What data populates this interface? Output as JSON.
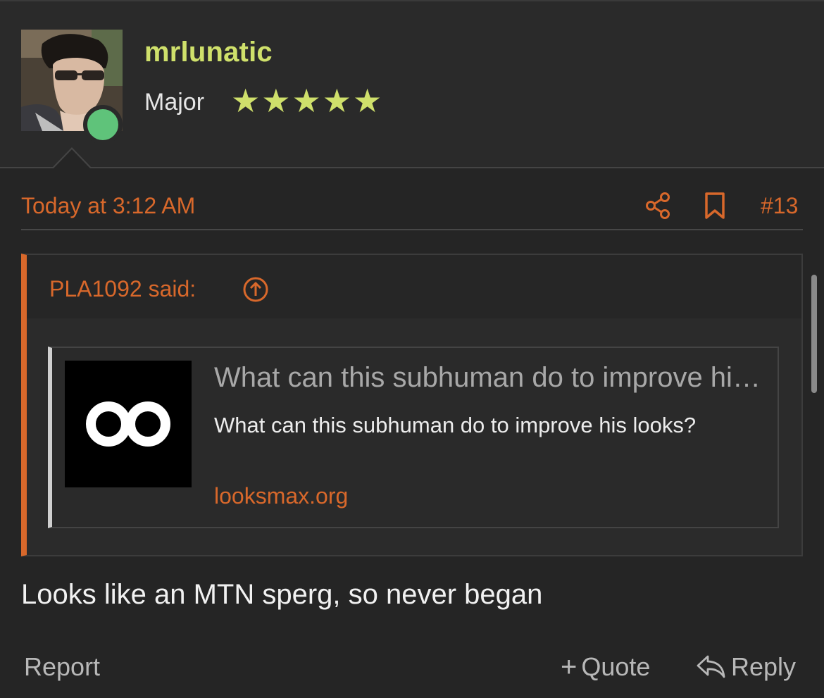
{
  "user": {
    "username": "mrlunatic",
    "title": "Major",
    "stars": "★★★★★",
    "rating": 5,
    "online": true,
    "avatar_icon": "user-avatar"
  },
  "post": {
    "time": "Today at 3:12 AM",
    "number": "#13",
    "body": "Looks like an MTN sperg, so never began"
  },
  "quote": {
    "author_label": "PLA1092 said:",
    "embed": {
      "title": "What can this subhuman do to improve his looks?",
      "description": "What can this subhuman do to improve his looks?",
      "domain": "looksmax.org",
      "thumb_icon": "looksmax-logo-icon"
    }
  },
  "actions": {
    "report": "Report",
    "quote": "Quote",
    "reply": "Reply"
  },
  "colors": {
    "accent": "#d8682b",
    "username": "#cfe06b",
    "online": "#5fc37a",
    "background": "#252525"
  }
}
